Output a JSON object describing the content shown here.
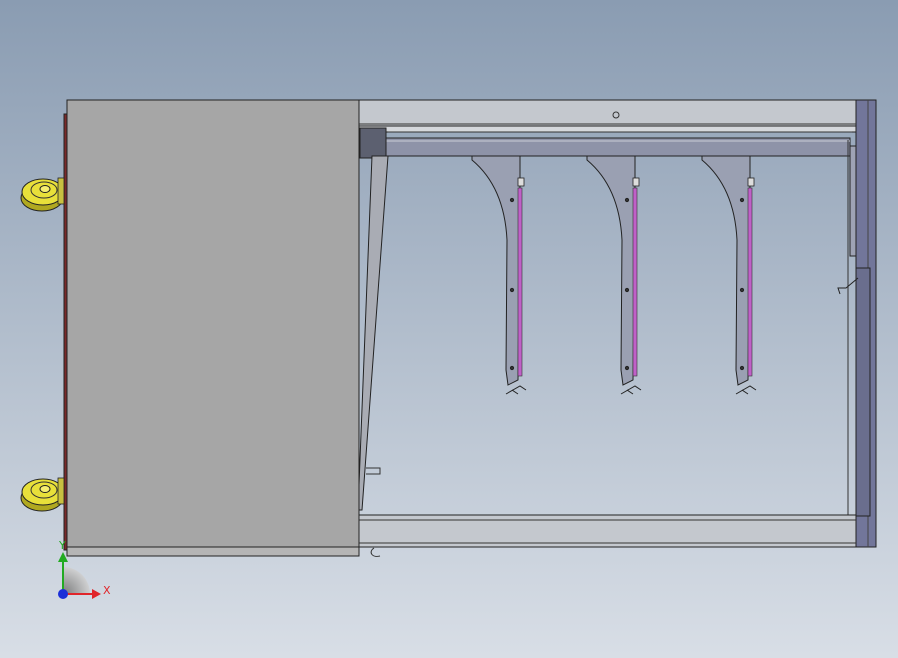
{
  "viewport": {
    "background_top": "#8a9cb2",
    "background_bottom": "#d8dee6"
  },
  "triad": {
    "x_label": "X",
    "y_label": "Y",
    "x_color": "#e0252a",
    "y_color": "#22aa22",
    "origin_color": "#1a2fd8"
  },
  "colors": {
    "door_panel": "#a6a6a6",
    "frame_light": "#c4c8ce",
    "frame_dark": "#5c6070",
    "right_panel": "#72769a",
    "caster_yellow": "#e8e03a",
    "bracket": "#9aa0b2",
    "magenta_strip": "#c060c8",
    "inner_bg": "#b8c2d0"
  },
  "model": {
    "brackets": [
      {
        "id": "left"
      },
      {
        "id": "middle"
      },
      {
        "id": "right"
      }
    ],
    "casters": [
      {
        "id": "top"
      },
      {
        "id": "bottom"
      }
    ]
  }
}
